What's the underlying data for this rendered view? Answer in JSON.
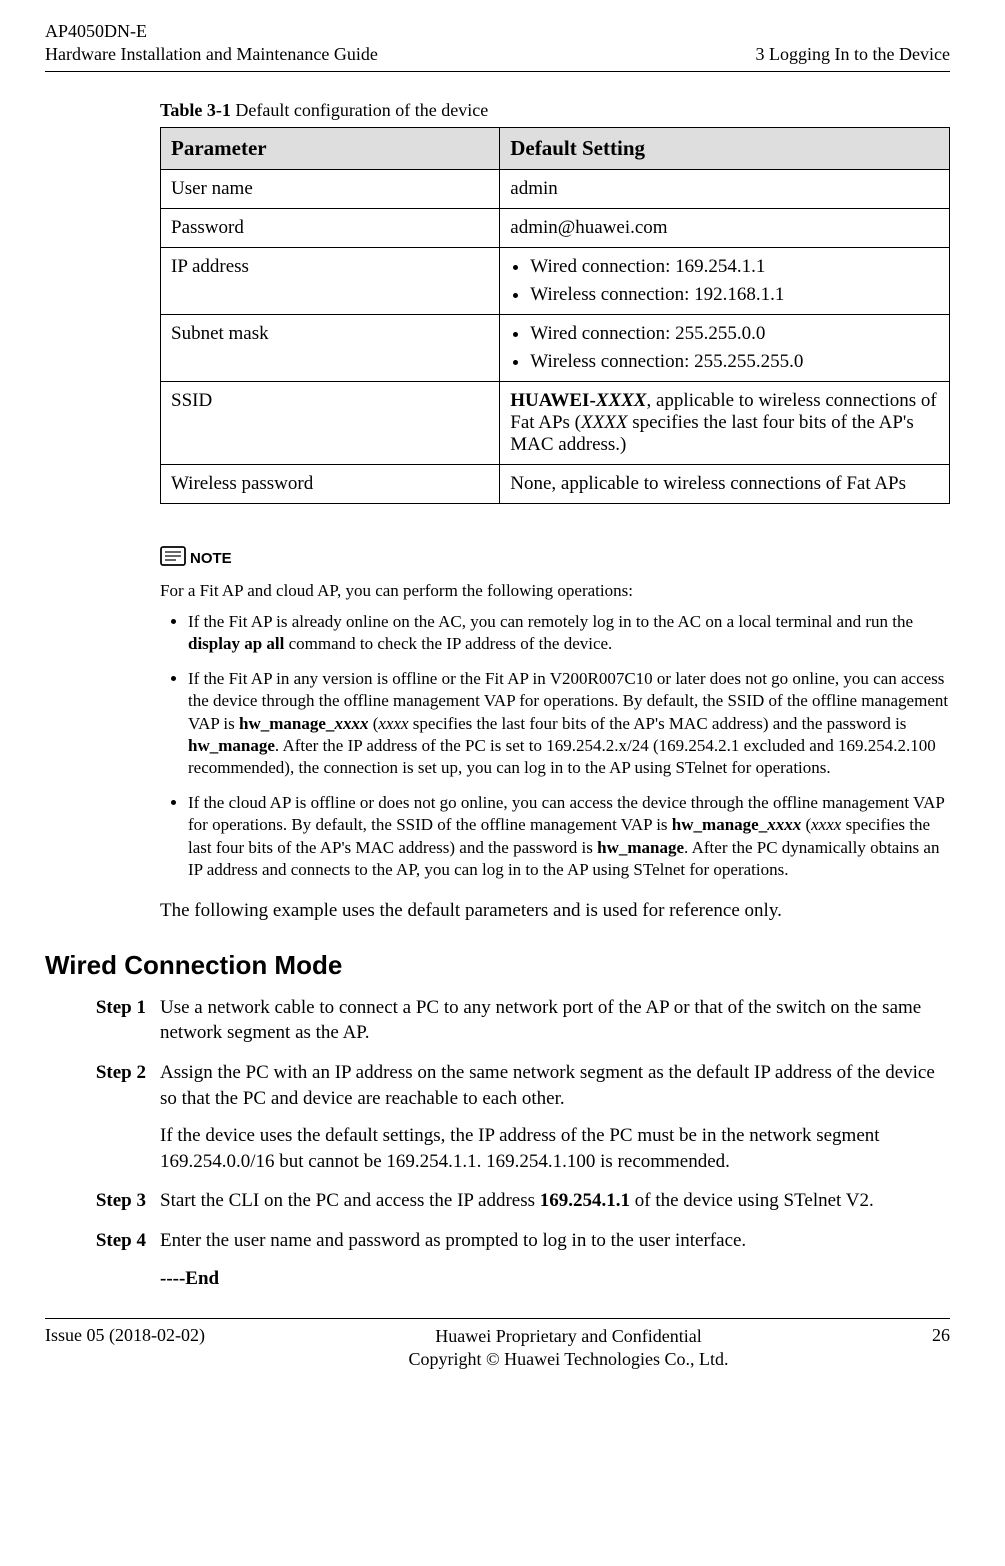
{
  "header": {
    "product": "AP4050DN-E",
    "doc_title": "Hardware Installation and Maintenance Guide",
    "section": "3 Logging In to the Device"
  },
  "table": {
    "caption_prefix": "Table 3-1",
    "caption_rest": " Default configuration of the device",
    "col1": "Parameter",
    "col2": "Default Setting",
    "rows": {
      "r0": {
        "param": "User name",
        "value": "admin"
      },
      "r1": {
        "param": "Password",
        "value": "admin@huawei.com"
      },
      "r2": {
        "param": "IP address",
        "items": {
          "i0": "Wired connection: 169.254.1.1",
          "i1": "Wireless connection: 192.168.1.1"
        }
      },
      "r3": {
        "param": "Subnet mask",
        "items": {
          "i0": "Wired connection: 255.255.0.0",
          "i1": "Wireless connection: 255.255.255.0"
        }
      },
      "r4": {
        "param": "SSID",
        "ssid_prefix": "HUAWEI-",
        "ssid_x": "XXXX",
        "ssid_mid": ", applicable to wireless connections of Fat APs (",
        "ssid_x2": "XXXX",
        "ssid_suffix": " specifies the last four bits of the AP's MAC address.)"
      },
      "r5": {
        "param": "Wireless password",
        "value": "None, applicable to wireless connections of Fat APs"
      }
    }
  },
  "note": {
    "label": "NOTE",
    "intro": "For a Fit AP and cloud AP, you can perform the following operations:",
    "b1": {
      "t1": "If the Fit AP is already online on the AC, you can remotely log in to the AC on a local terminal and run the ",
      "bold": "display ap all",
      "t2": " command to check the IP address of the device."
    },
    "b2": {
      "t1": "If the Fit AP in any version is offline or the Fit AP in V200R007C10 or later does not go online, you can access the device through the offline management VAP for operations. By default, the SSID of the offline management VAP is ",
      "bi1": "hw_manage_",
      "bi1x": "xxxx",
      "t2": " (",
      "i1": "xxxx",
      "t3": " specifies the last four bits of the AP's MAC address) and the password is ",
      "bold2": "hw_manage",
      "t4": ". After the IP address of the PC is set to 169.254.2.x/24 (169.254.2.1 excluded and 169.254.2.100 recommended), the connection is set up, you can log in to the AP using STelnet for operations."
    },
    "b3": {
      "t1": "If the cloud AP is offline or does not go online, you can access the device through the offline management VAP for operations. By default, the SSID of the offline management VAP is ",
      "bi1": "hw_manage_",
      "bi1x": "xxxx",
      "t2": " (",
      "i1": "xxxx",
      "t3": " specifies the last four bits of the AP's MAC address) and the password is ",
      "bold2": "hw_manage",
      "t4": ". After the PC dynamically obtains an IP address and connects to the AP, you can log in to the AP using STelnet for operations."
    }
  },
  "following_example": "The following example uses the default parameters and is used for reference only.",
  "section_heading": "Wired Connection Mode",
  "steps": {
    "s1": {
      "label": "Step 1",
      "text": "Use a network cable to connect a PC to any network port of the AP or that of the switch on the same network segment as the AP."
    },
    "s2": {
      "label": "Step 2",
      "p1": "Assign the PC with an IP address on the same network segment as the default IP address of the device so that the PC and device are reachable to each other.",
      "p2": "If the device uses the default settings, the IP address of the PC must be in the network segment 169.254.0.0/16 but cannot be 169.254.1.1. 169.254.1.100 is recommended."
    },
    "s3": {
      "label": "Step 3",
      "t1": "Start the CLI on the PC and access the IP address ",
      "bold": "169.254.1.1",
      "t2": " of the device using STelnet V2."
    },
    "s4": {
      "label": "Step 4",
      "text": "Enter the user name and password as prompted to log in to the user interface."
    }
  },
  "end_marker": "----End",
  "footer": {
    "left": "Issue 05 (2018-02-02)",
    "center1": "Huawei Proprietary and Confidential",
    "center2": "Copyright © Huawei Technologies Co., Ltd.",
    "right": "26"
  }
}
